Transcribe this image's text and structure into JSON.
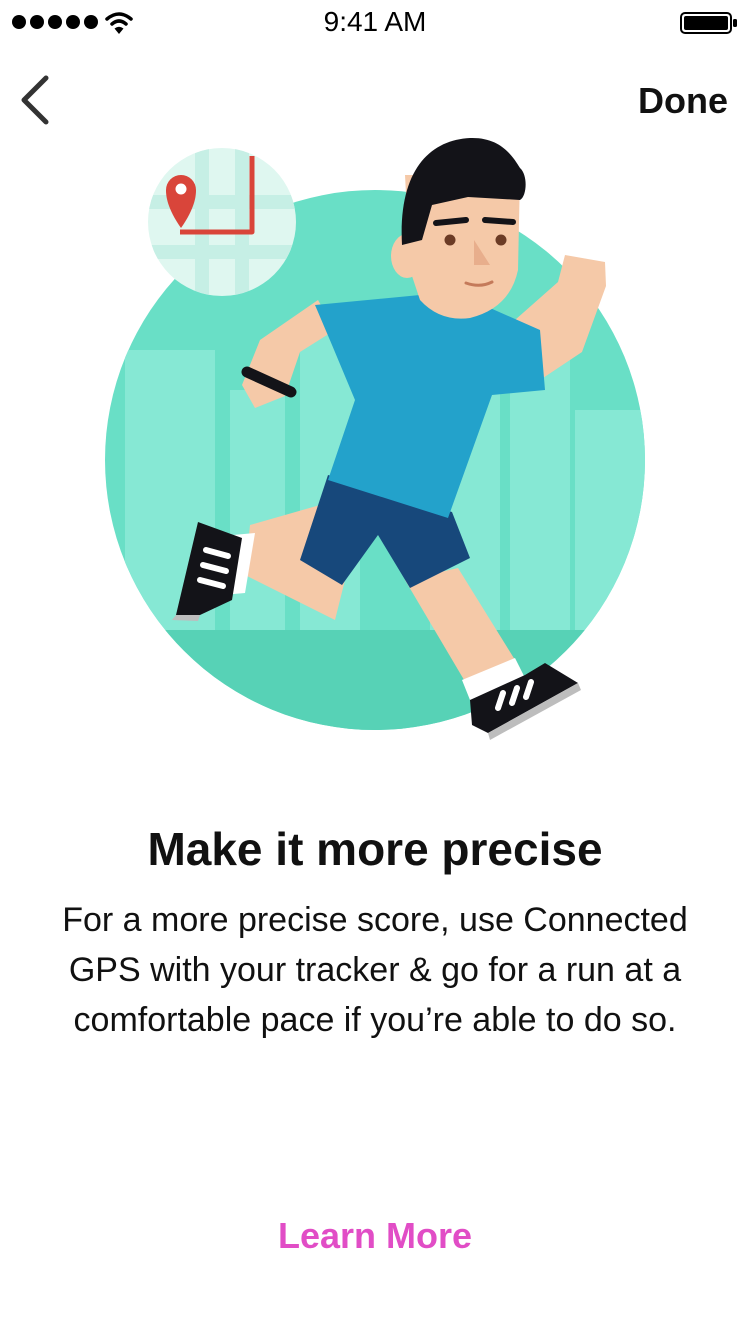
{
  "status_bar": {
    "time": "9:41 AM",
    "signal_bars": 5,
    "battery_level": 1.0
  },
  "nav": {
    "back_icon": "chevron-left-icon",
    "done_label": "Done"
  },
  "illustration": {
    "subject": "runner-with-gps-map",
    "icons": [
      "map-pin-icon",
      "fitness-tracker-icon"
    ]
  },
  "content": {
    "title": "Make it more precise",
    "body": "For a more precise score, use Connected GPS with your tracker & go for a run at a comfortable pace if you’re able to do so.",
    "learn_more_label": "Learn More"
  },
  "colors": {
    "accent": "#e14dc6",
    "circle": "#69dfc6",
    "shirt": "#23a2cb",
    "shorts": "#17487b",
    "skin": "#f5c9a8",
    "hair": "#131318",
    "map_route": "#d9453a"
  }
}
